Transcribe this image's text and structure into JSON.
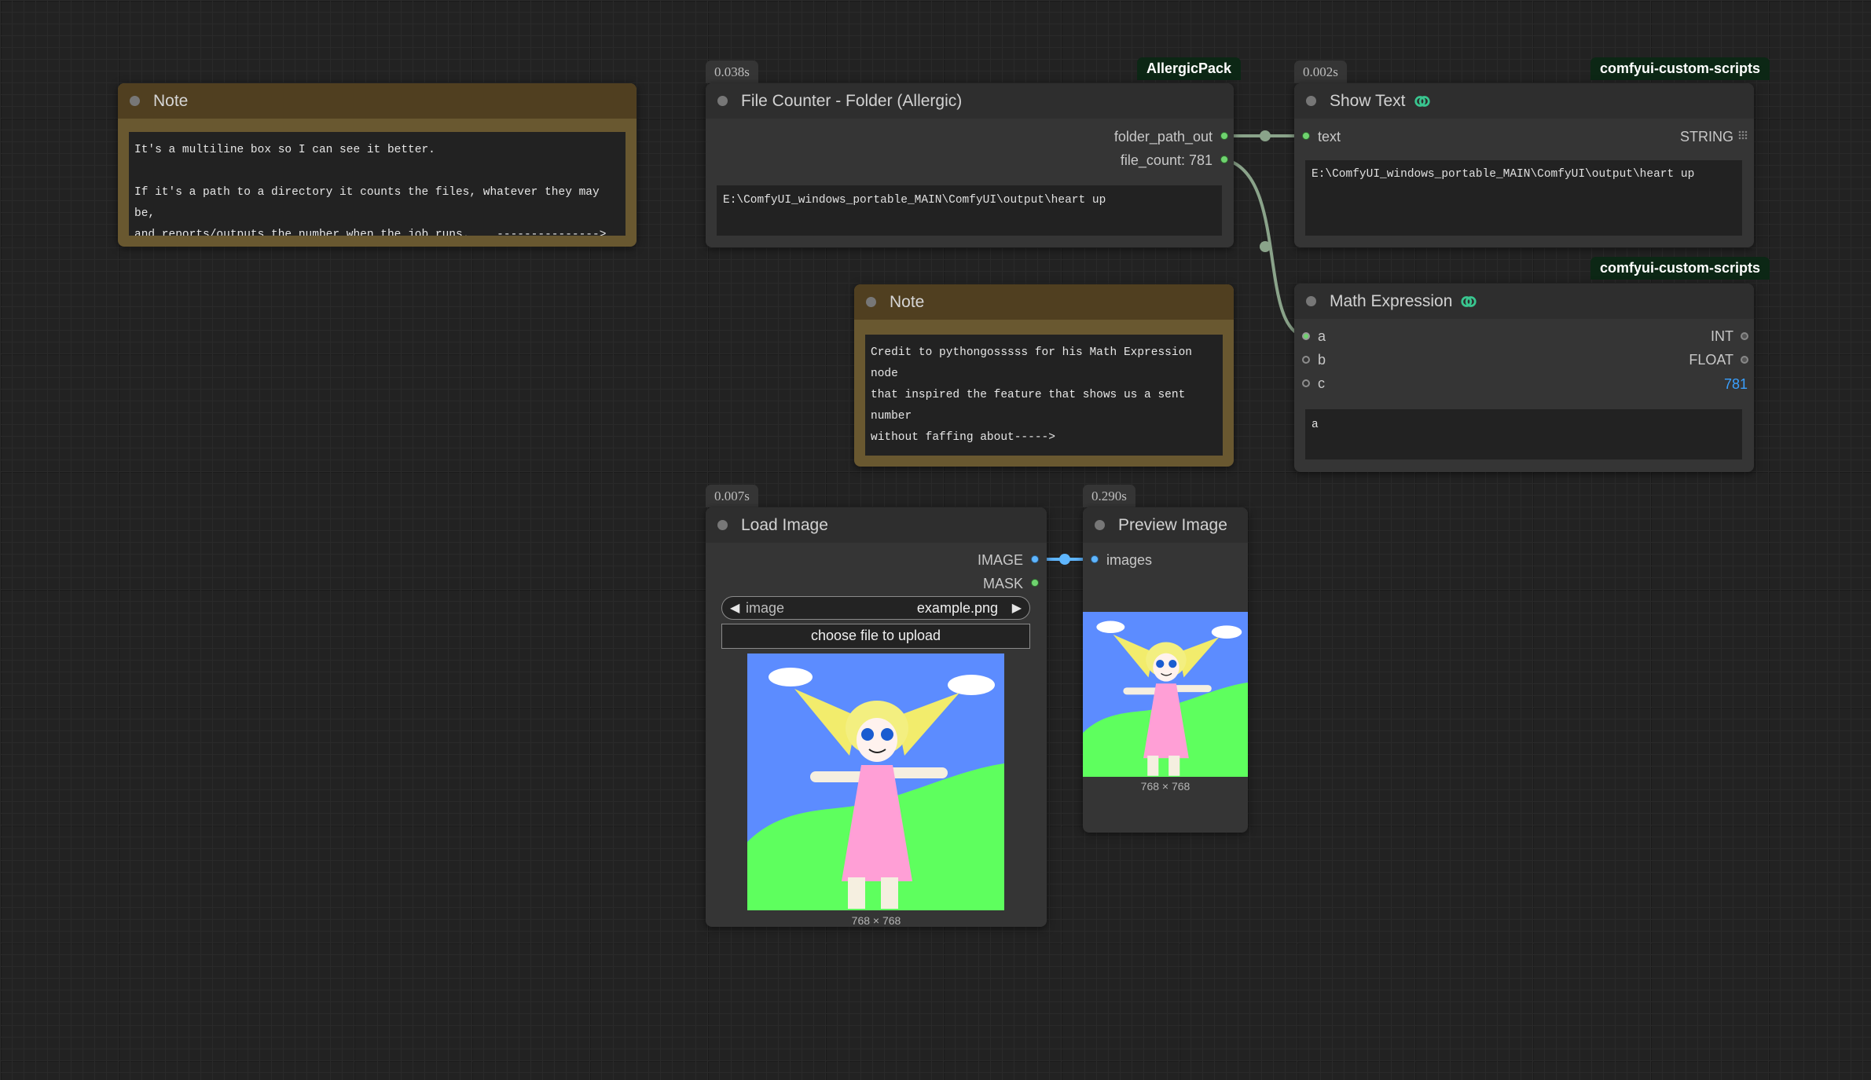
{
  "canvas": {
    "colors": {
      "background": "#222222",
      "node": "#353535",
      "note": "#695830",
      "link": "#8aa38a"
    }
  },
  "notes": [
    {
      "title": "Note",
      "text": "It's a multiline box so I can see it better.\n\nIf it's a path to a directory it counts the files, whatever they may be,\nand reports/outputs the number when the job runs.    --------------->"
    },
    {
      "title": "Note",
      "text": "Credit to pythongosssss for his Math Expression node\nthat inspired the feature that shows us a sent number\nwithout faffing about----->"
    }
  ],
  "file_counter": {
    "time": "0.038s",
    "pack": "AllergicPack",
    "title": "File Counter - Folder (Allergic)",
    "outputs": [
      "folder_path_out",
      "file_count: 781"
    ],
    "path_value": "E:\\ComfyUI_windows_portable_MAIN\\ComfyUI\\output\\heart up"
  },
  "show_text": {
    "time": "0.002s",
    "pack": "comfyui-custom-scripts",
    "title": "Show Text",
    "input": "text",
    "output": "STRING",
    "output_icon": "grid-icon",
    "value": "E:\\ComfyUI_windows_portable_MAIN\\ComfyUI\\output\\heart up"
  },
  "math_expression": {
    "pack": "comfyui-custom-scripts",
    "title": "Math Expression",
    "inputs": [
      "a",
      "b",
      "c"
    ],
    "outputs": [
      "INT",
      "FLOAT"
    ],
    "result": "781",
    "expression": "a",
    "result_color": "#3aa0ff"
  },
  "load_image": {
    "time": "0.007s",
    "title": "Load Image",
    "outputs": [
      "IMAGE",
      "MASK"
    ],
    "combo_label": "image",
    "combo_value": "example.png",
    "upload_label": "choose file to upload",
    "size": "768 × 768"
  },
  "preview_image": {
    "time": "0.290s",
    "title": "Preview Image",
    "input": "images",
    "size": "768 × 768"
  }
}
